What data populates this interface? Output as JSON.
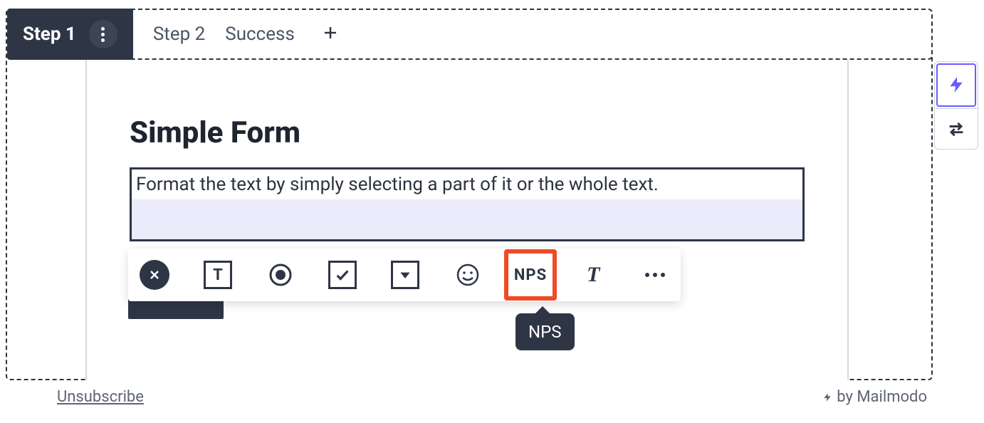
{
  "tabs": {
    "step1": "Step 1",
    "step2": "Step 2",
    "success": "Success"
  },
  "form": {
    "title": "Simple Form",
    "text_block": "Format the text by simply selecting a part of it or the whole text."
  },
  "toolbar": {
    "nps_label": "NPS"
  },
  "tooltip": {
    "nps": "NPS"
  },
  "footer": {
    "unsubscribe": "Unsubscribe",
    "credit_by": "by Mailmodo"
  }
}
